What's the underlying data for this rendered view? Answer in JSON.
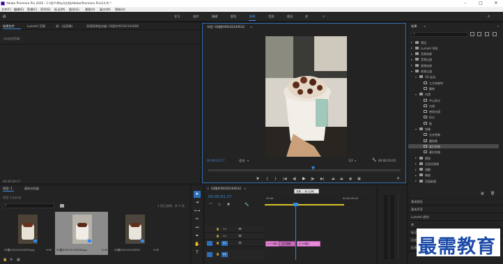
{
  "titlebar": {
    "title": "Adobe Premiere Pro 2020 - C:\\用户\\Mayi\\文档\\Adobe\\Premiere Pro\\14.0\\ *"
  },
  "menu": [
    "文件(F)",
    "编辑(E)",
    "剪辑(C)",
    "序列(S)",
    "标记(M)",
    "图形(G)",
    "视图(V)",
    "窗口(W)",
    "帮助(H)"
  ],
  "workspaces": [
    "学习",
    "组件",
    "编辑",
    "颜色",
    "效果",
    "音频",
    "图形",
    "库"
  ],
  "workspace_active": "效果",
  "source_panel": {
    "tabs": [
      "效果控件",
      "Lumetri 范围",
      "源：(无剪辑)",
      "音频剪辑混合器: 02图片00102104500"
    ],
    "no_selection": "(未选择剪辑)",
    "timecode": "00:00:00:17"
  },
  "program": {
    "title": "节目: 02图片00102104532",
    "timecode_left": "00:00:01:17",
    "fit": "适合",
    "ratio": "1/2",
    "timecode_right": "00:00:03:01"
  },
  "project": {
    "tabs": [
      "项目: 1",
      "媒体浏览器"
    ],
    "project_name": "项目 1.prproj",
    "selection_info": "1 项已选择，共 3 项",
    "items": [
      {
        "name": "02图片00102104500.jpg",
        "duration": "5:00"
      },
      {
        "name": "02图片00102104538.jpg",
        "duration": "5:00"
      },
      {
        "name": "02图片00102104532",
        "duration": "5:00"
      }
    ]
  },
  "timeline": {
    "tab": "02图片00102104532",
    "timecode": "00:00:01:17",
    "ruler_left": "00:00",
    "ruler_right": "00:00:05:00",
    "tooltip": "设置 — 帧 (比例)",
    "tracks": [
      "V3",
      "V2",
      "V1",
      "A1"
    ],
    "clips": [
      "fx 02图片",
      "交叉溶解",
      "fx 02图片"
    ]
  },
  "effects": {
    "title": "效果",
    "tree": [
      {
        "label": "预设",
        "indent": 0,
        "open": false
      },
      {
        "label": "Lumetri 预设",
        "indent": 0,
        "open": false
      },
      {
        "label": "音频效果",
        "indent": 0,
        "open": false
      },
      {
        "label": "音频过渡",
        "indent": 0,
        "open": false
      },
      {
        "label": "视频效果",
        "indent": 0,
        "open": false
      },
      {
        "label": "视频过渡",
        "indent": 0,
        "open": true
      },
      {
        "label": "3D 运动",
        "indent": 1,
        "open": true
      },
      {
        "label": "立方体旋转",
        "indent": 2,
        "file": true
      },
      {
        "label": "翻转",
        "indent": 2,
        "file": true
      },
      {
        "label": "内滑",
        "indent": 1,
        "open": true
      },
      {
        "label": "中心拆分",
        "indent": 2,
        "file": true
      },
      {
        "label": "内滑",
        "indent": 2,
        "file": true
      },
      {
        "label": "带状内滑",
        "indent": 2,
        "file": true
      },
      {
        "label": "拆分",
        "indent": 2,
        "file": true
      },
      {
        "label": "推",
        "indent": 2,
        "file": true
      },
      {
        "label": "划像",
        "indent": 1,
        "open": true
      },
      {
        "label": "交叉划像",
        "indent": 2,
        "file": true
      },
      {
        "label": "圆划像",
        "indent": 2,
        "file": true
      },
      {
        "label": "盒形划像",
        "indent": 2,
        "file": true,
        "selected": true
      },
      {
        "label": "菱形划像",
        "indent": 2,
        "file": true
      },
      {
        "label": "擦除",
        "indent": 1,
        "open": false
      },
      {
        "label": "沉浸式视频",
        "indent": 1,
        "open": false
      },
      {
        "label": "溶解",
        "indent": 1,
        "open": false
      },
      {
        "label": "缩放",
        "indent": 1,
        "open": false
      },
      {
        "label": "页面剥落",
        "indent": 1,
        "open": false
      }
    ],
    "lower_panels": [
      "基本图形",
      "基本声音",
      "Lumetri 颜色",
      "库",
      "标记",
      "历史记录",
      "信息"
    ]
  },
  "watermark": "最需教育",
  "colors": {
    "accent": "#2d8ceb",
    "clip": "#e58bd8",
    "tooltip_bg": "#e8e8e8"
  }
}
